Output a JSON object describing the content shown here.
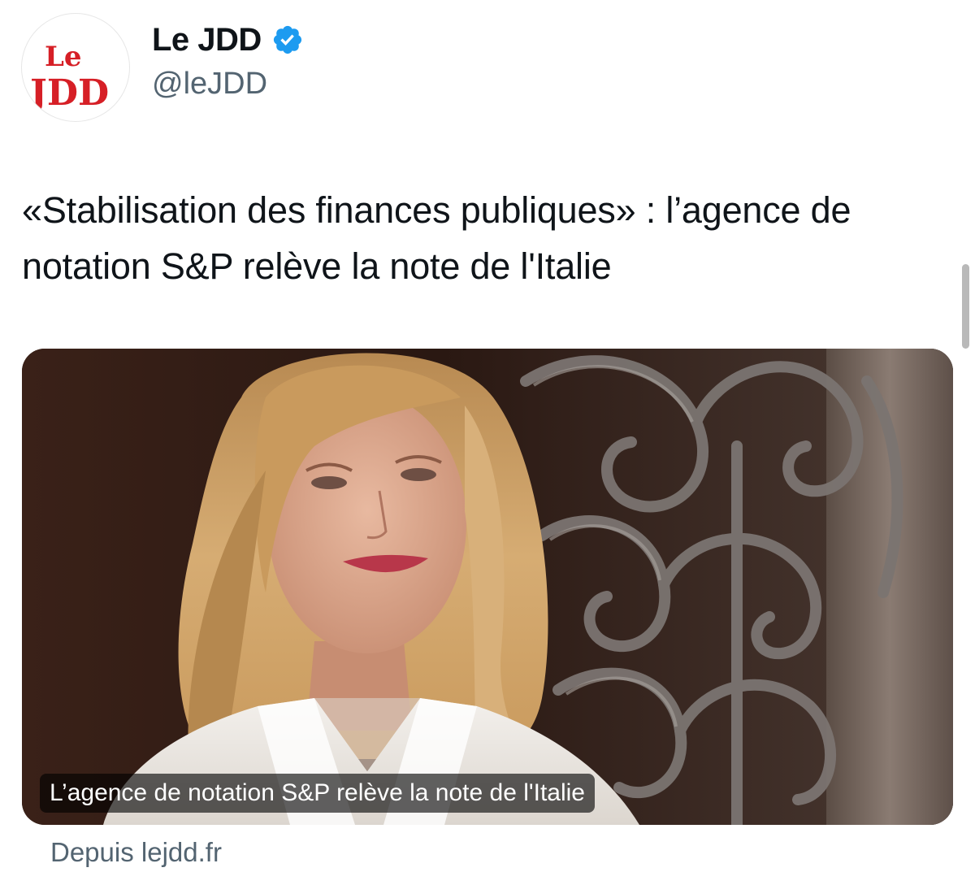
{
  "account": {
    "avatar_line1": "Le",
    "avatar_line2": "JDD",
    "display_name": "Le JDD",
    "handle": "@leJDD",
    "verified": true,
    "brand_color": "#d61f26",
    "verified_color": "#1d9bf0"
  },
  "tweet": {
    "text": "«Stabilisation des finances publiques» : l’agence de notation S&P relève la note de l'Italie"
  },
  "card": {
    "image_icon": "news-photo",
    "caption": "L’agence de notation S&P relève la note de l'Italie",
    "source": "Depuis lejdd.fr"
  }
}
